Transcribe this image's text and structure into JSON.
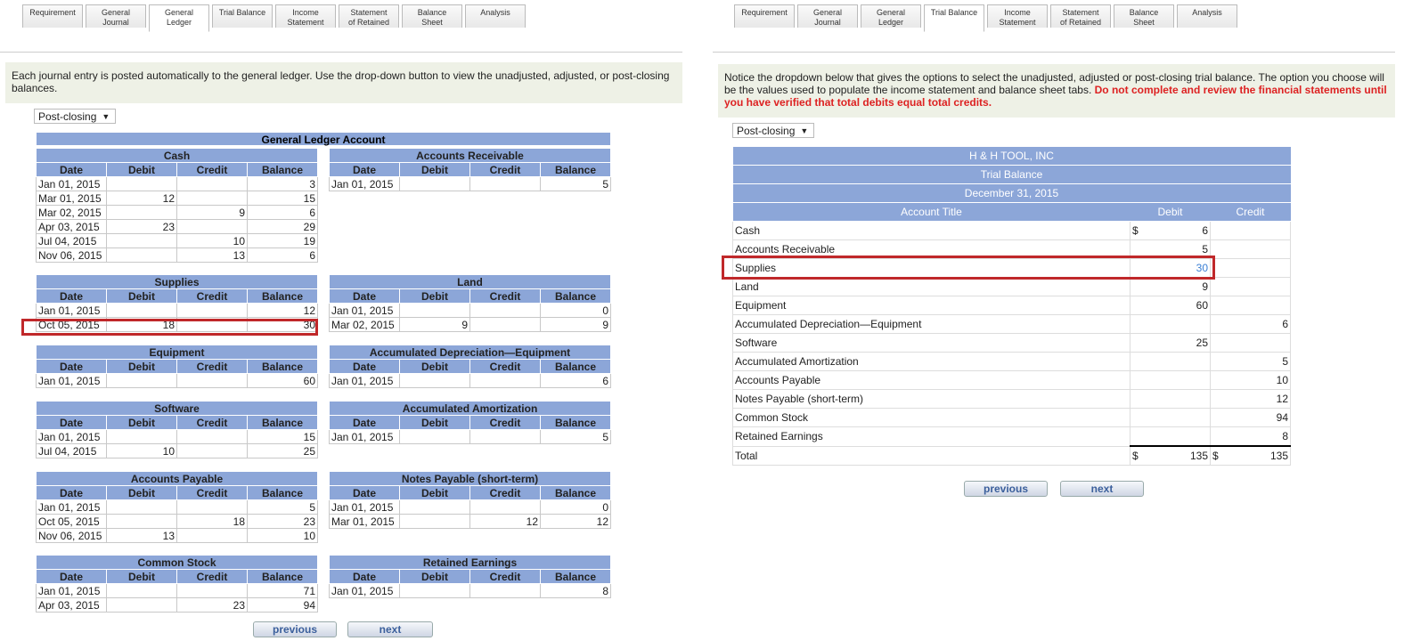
{
  "left_panel": {
    "tabs": [
      "Requirement",
      "General\nJournal",
      "General\nLedger",
      "Trial Balance",
      "Income\nStatement",
      "Statement\nof Retained",
      "Balance\nSheet",
      "Analysis"
    ],
    "active_tab": "General Ledger",
    "notice": "Each journal entry is posted automatically to the general ledger. Use the drop-down button to view the unadjusted, adjusted, or post-closing balances.",
    "dropdown": "Post-closing",
    "ledger_header": "General Ledger Account",
    "columns": [
      "Date",
      "Debit",
      "Credit",
      "Balance"
    ],
    "accounts": [
      {
        "name": "Cash",
        "rows": [
          [
            "Jan 01, 2015",
            "",
            "",
            "3"
          ],
          [
            "Mar 01, 2015",
            "12",
            "",
            "15"
          ],
          [
            "Mar 02, 2015",
            "",
            "9",
            "6"
          ],
          [
            "Apr 03, 2015",
            "23",
            "",
            "29"
          ],
          [
            "Jul 04, 2015",
            "",
            "10",
            "19"
          ],
          [
            "Nov 06, 2015",
            "",
            "13",
            "6"
          ]
        ]
      },
      {
        "name": "Accounts Receivable",
        "rows": [
          [
            "Jan 01, 2015",
            "",
            "",
            "5"
          ]
        ]
      },
      {
        "name": "Supplies",
        "rows": [
          [
            "Jan 01, 2015",
            "",
            "",
            "12"
          ],
          [
            "Oct 05, 2015",
            "18",
            "",
            "30"
          ]
        ]
      },
      {
        "name": "Land",
        "rows": [
          [
            "Jan 01, 2015",
            "",
            "",
            "0"
          ],
          [
            "Mar 02, 2015",
            "9",
            "",
            "9"
          ]
        ]
      },
      {
        "name": "Equipment",
        "rows": [
          [
            "Jan 01, 2015",
            "",
            "",
            "60"
          ]
        ]
      },
      {
        "name": "Accumulated Depreciation—Equipment",
        "rows": [
          [
            "Jan 01, 2015",
            "",
            "",
            "6"
          ]
        ]
      },
      {
        "name": "Software",
        "rows": [
          [
            "Jan 01, 2015",
            "",
            "",
            "15"
          ],
          [
            "Jul 04, 2015",
            "10",
            "",
            "25"
          ]
        ]
      },
      {
        "name": "Accumulated Amortization",
        "rows": [
          [
            "Jan 01, 2015",
            "",
            "",
            "5"
          ]
        ]
      },
      {
        "name": "Accounts Payable",
        "rows": [
          [
            "Jan 01, 2015",
            "",
            "",
            "5"
          ],
          [
            "Oct 05, 2015",
            "",
            "18",
            "23"
          ],
          [
            "Nov 06, 2015",
            "13",
            "",
            "10"
          ]
        ]
      },
      {
        "name": "Notes Payable (short-term)",
        "rows": [
          [
            "Jan 01, 2015",
            "",
            "",
            "0"
          ],
          [
            "Mar 01, 2015",
            "",
            "12",
            "12"
          ]
        ]
      },
      {
        "name": "Common Stock",
        "rows": [
          [
            "Jan 01, 2015",
            "",
            "",
            "71"
          ],
          [
            "Apr 03, 2015",
            "",
            "23",
            "94"
          ]
        ]
      },
      {
        "name": "Retained Earnings",
        "rows": [
          [
            "Jan 01, 2015",
            "",
            "",
            "8"
          ]
        ]
      }
    ],
    "previous": "previous",
    "next": "next"
  },
  "right_panel": {
    "tabs": [
      "Requirement",
      "General\nJournal",
      "General\nLedger",
      "Trial Balance",
      "Income\nStatement",
      "Statement\nof Retained",
      "Balance\nSheet",
      "Analysis"
    ],
    "active_tab": "Trial Balance",
    "notice_plain": "Notice the dropdown below that gives the options to select the unadjusted, adjusted or post-closing trial balance. The option you choose will be the values used to populate the income statement and balance sheet tabs.",
    "notice_red": "Do not complete and review the financial statements until you have verified that total debits equal total credits.",
    "dropdown": "Post-closing",
    "company": "H & H TOOL, INC",
    "report": "Trial Balance",
    "date": "December 31, 2015",
    "col_title": "Account Title",
    "col_debit": "Debit",
    "col_credit": "Credit",
    "currency": "$",
    "rows": [
      {
        "title": "Cash",
        "debit": "6",
        "credit": ""
      },
      {
        "title": "Accounts Receivable",
        "debit": "5",
        "credit": ""
      },
      {
        "title": "Supplies",
        "debit": "30",
        "credit": ""
      },
      {
        "title": "Land",
        "debit": "9",
        "credit": ""
      },
      {
        "title": "Equipment",
        "debit": "60",
        "credit": ""
      },
      {
        "title": "Accumulated Depreciation—Equipment",
        "debit": "",
        "credit": "6"
      },
      {
        "title": "Software",
        "debit": "25",
        "credit": ""
      },
      {
        "title": "Accumulated Amortization",
        "debit": "",
        "credit": "5"
      },
      {
        "title": "Accounts Payable",
        "debit": "",
        "credit": "10"
      },
      {
        "title": "Notes Payable (short-term)",
        "debit": "",
        "credit": "12"
      },
      {
        "title": "Common Stock",
        "debit": "",
        "credit": "94"
      },
      {
        "title": "Retained Earnings",
        "debit": "",
        "credit": "8"
      }
    ],
    "total_label": "Total",
    "total_debit": "135",
    "total_credit": "135",
    "previous": "previous",
    "next": "next"
  }
}
